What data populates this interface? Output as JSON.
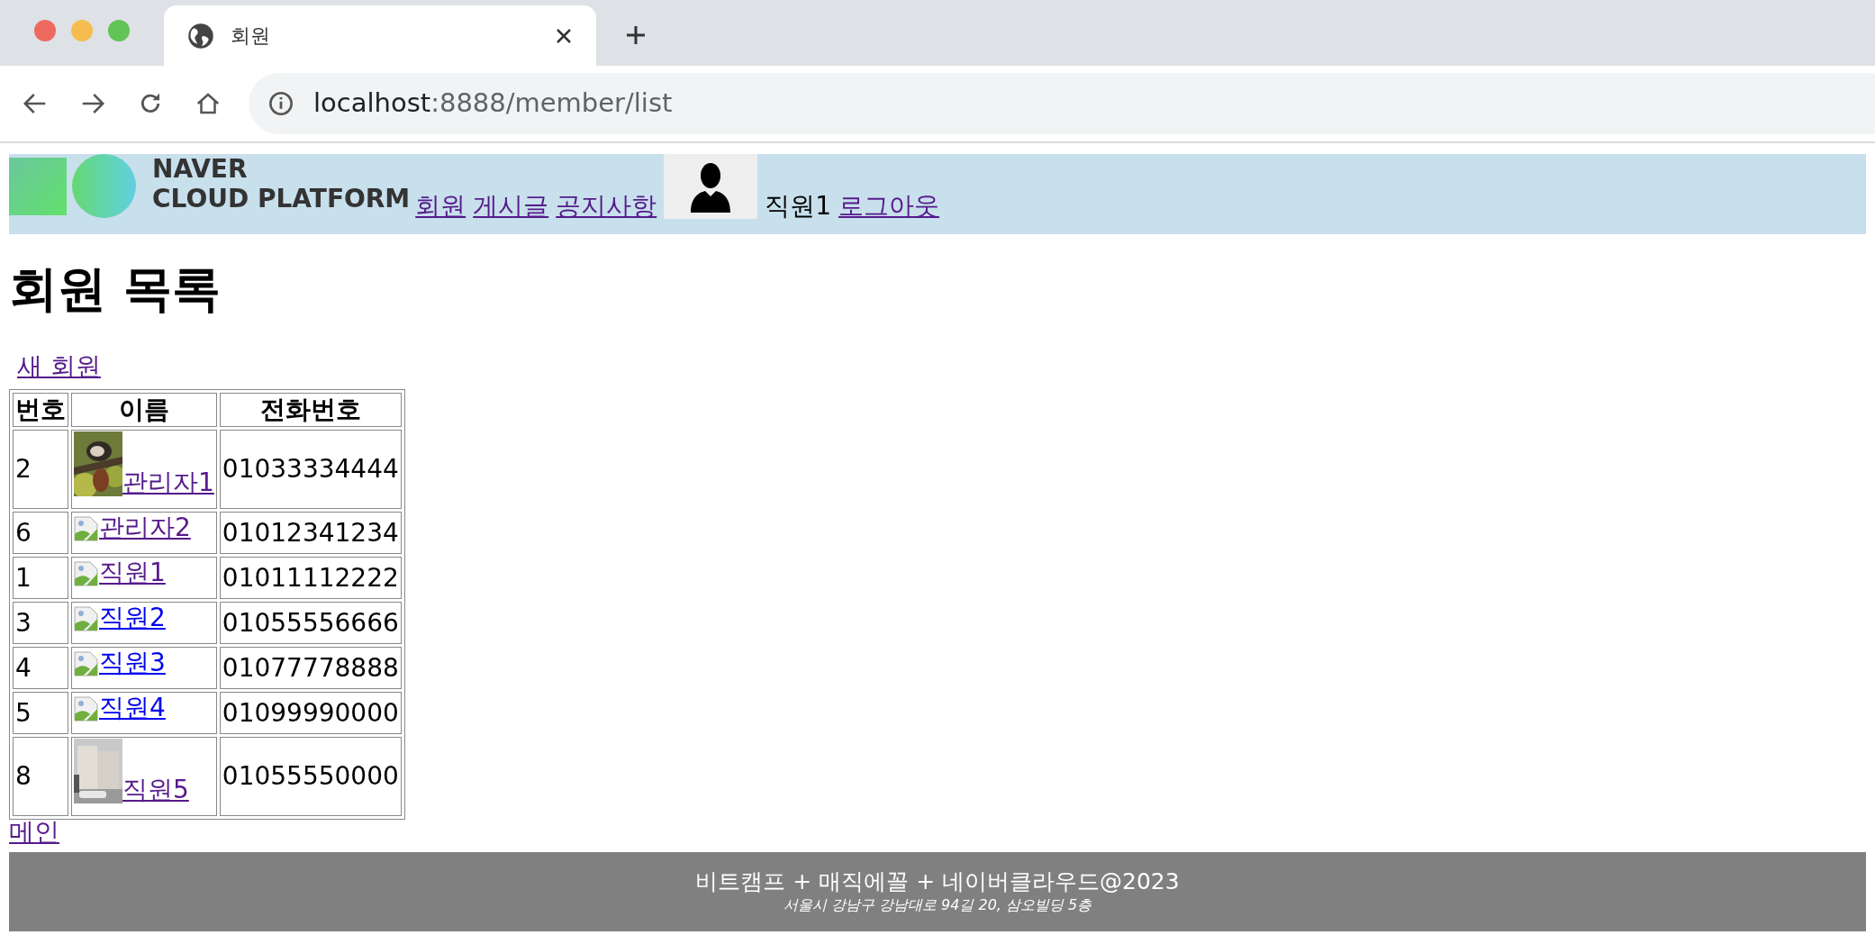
{
  "browser": {
    "tab_title": "회원",
    "url_host": "localhost",
    "url_path": ":8888/member/list"
  },
  "header": {
    "logo_lines": [
      "NAVER",
      "CLOUD PLATFORM"
    ],
    "nav": [
      {
        "label": "회원",
        "visited": true
      },
      {
        "label": "게시글",
        "visited": true
      },
      {
        "label": "공지사항",
        "visited": true
      }
    ],
    "user_name": "직원1",
    "logout": {
      "label": "로그아웃",
      "visited": true
    }
  },
  "heading": "회원 목록",
  "new_member_link": {
    "label": "새 회원",
    "visited": true
  },
  "table": {
    "columns": [
      "번호",
      "이름",
      "전화번호"
    ],
    "rows": [
      {
        "no": "2",
        "name": "관리자1",
        "visited": true,
        "phone": "01033334444"
      },
      {
        "no": "6",
        "kind": "broken",
        "name": "관리자2",
        "visited": true,
        "phone": "01012341234"
      },
      {
        "no": "1",
        "kind": "broken",
        "name": "직원1",
        "visited": true,
        "phone": "01011112222"
      },
      {
        "no": "3",
        "kind": "broken",
        "name": "직원2",
        "visited": false,
        "phone": "01055556666"
      },
      {
        "no": "4",
        "kind": "broken",
        "name": "직원3",
        "visited": false,
        "phone": "01077778888"
      },
      {
        "no": "5",
        "kind": "broken",
        "name": "직원4",
        "visited": false,
        "phone": "01099990000"
      },
      {
        "no": "8",
        "name": "직원5",
        "visited": true,
        "phone": "01055550000"
      }
    ]
  },
  "main_link": {
    "label": "메인",
    "visited": true
  },
  "footer": {
    "title": "비트캠프 + 매직에꼴 + 네이버클라우드@2023",
    "address": "서울시 강남구 강남대로 94길 20, 삼오빌딩 5층"
  }
}
